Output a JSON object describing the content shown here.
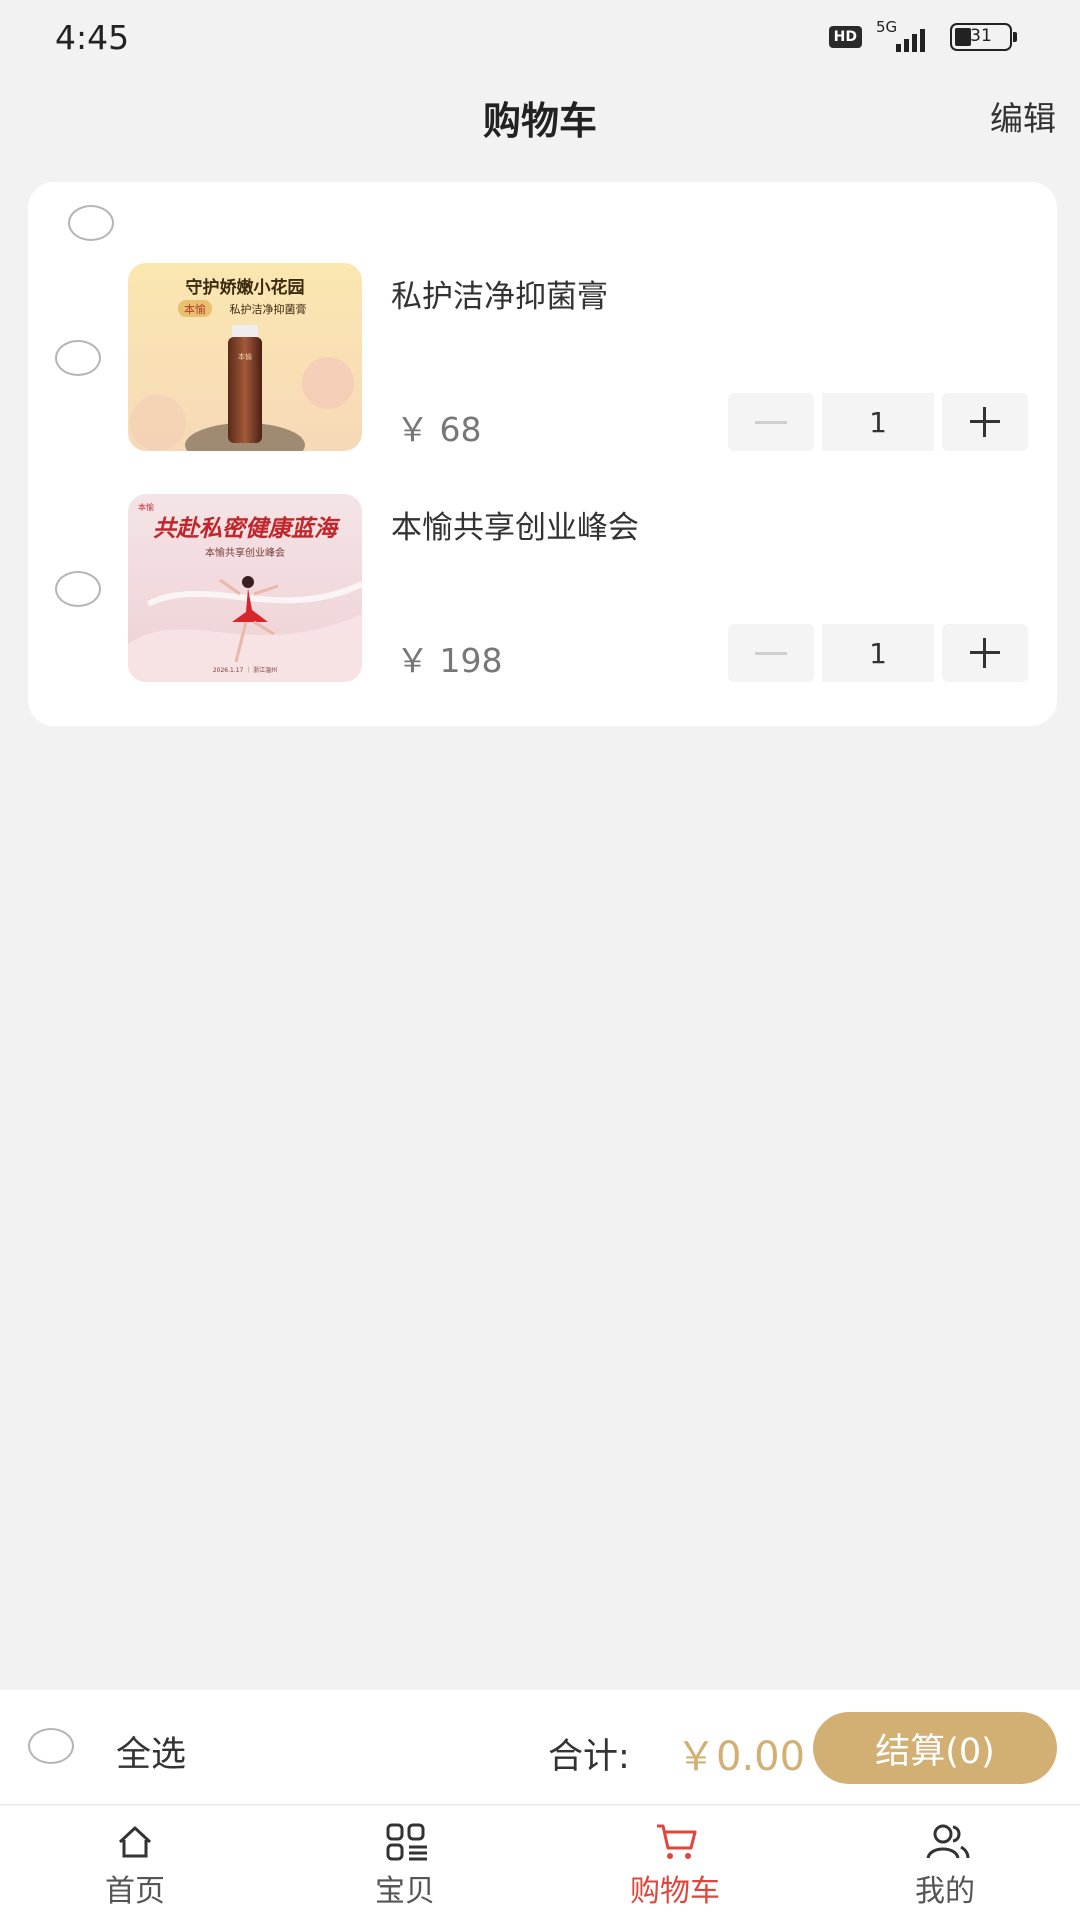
{
  "status_bar": {
    "time": "4:45",
    "hd": "HD",
    "network": "5G",
    "battery": "31",
    "battery_level": 0.31
  },
  "header": {
    "title": "购物车",
    "edit_label": "编辑"
  },
  "cart": {
    "items": [
      {
        "name": "私护洁净抑菌膏",
        "price": "￥ 68",
        "quantity": "1",
        "image": {
          "headline": "守护娇嫩小花园",
          "brand": "本愉",
          "product": "私护洁净抑菌膏",
          "bottle_label": "本愉"
        }
      },
      {
        "name": "本愉共享创业峰会",
        "price": "￥ 198",
        "quantity": "1",
        "image": {
          "brand": "本愉",
          "headline": "共赴私密健康蓝海",
          "subtitle": "本愉共享创业峰会",
          "footer": "2026.1.17 ｜ 浙江温州"
        }
      }
    ]
  },
  "checkout": {
    "select_all_label": "全选",
    "total_label": "合计:",
    "total_value": "￥0.00",
    "checkout_label": "结算(0)",
    "accent_color": "#d2b074"
  },
  "tabs": [
    {
      "label": "首页",
      "icon": "home-icon"
    },
    {
      "label": "宝贝",
      "icon": "grid-icon"
    },
    {
      "label": "购物车",
      "icon": "cart-icon",
      "active": true
    },
    {
      "label": "我的",
      "icon": "user-icon"
    }
  ],
  "colors": {
    "active_tab": "#e0463a",
    "background": "#f2f2f2"
  }
}
